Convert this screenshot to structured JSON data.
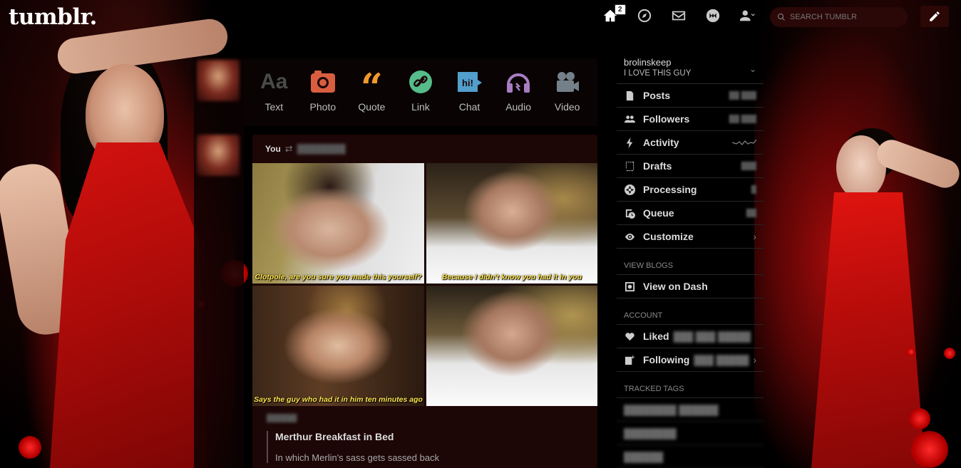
{
  "header": {
    "logo": "tumblr.",
    "home_badge": "2",
    "search_placeholder": "Search Tumblr"
  },
  "post_types": [
    {
      "label": "Text",
      "icon": "text-icon",
      "color": "#4a4a4a"
    },
    {
      "label": "Photo",
      "icon": "camera-icon",
      "color": "#d95e40"
    },
    {
      "label": "Quote",
      "icon": "quote-icon",
      "color": "#f2992e"
    },
    {
      "label": "Link",
      "icon": "link-icon",
      "color": "#56bc8a"
    },
    {
      "label": "Chat",
      "icon": "chat-icon",
      "color": "#529ecc"
    },
    {
      "label": "Audio",
      "icon": "headphones-icon",
      "color": "#a77dc2"
    },
    {
      "label": "Video",
      "icon": "video-camera-icon",
      "color": "#748089"
    }
  ],
  "post": {
    "author": "You",
    "gifs": [
      {
        "caption": "Clotpole, are you sure you made this yourself?"
      },
      {
        "caption": "Because I didn't know you had it in you"
      },
      {
        "caption": "Says the guy who had it in him ten minutes ago"
      },
      {
        "caption": ""
      }
    ],
    "quote_title": "Merthur Breakfast in Bed",
    "quote_text": "In which Merlin's sass gets sassed back"
  },
  "sidebar": {
    "blog_name": "brolinskeep",
    "blog_title": "I LOVE THIS GUY",
    "items": [
      {
        "label": "Posts",
        "icon": "posts-icon"
      },
      {
        "label": "Followers",
        "icon": "followers-icon"
      },
      {
        "label": "Activity",
        "icon": "activity-icon"
      },
      {
        "label": "Drafts",
        "icon": "drafts-icon"
      },
      {
        "label": "Processing",
        "icon": "processing-icon"
      },
      {
        "label": "Queue",
        "icon": "queue-icon"
      },
      {
        "label": "Customize",
        "icon": "eye-icon"
      }
    ],
    "view_blogs_label": "View Blogs",
    "view_on_dash": "View on Dash",
    "account_label": "Account",
    "liked_label": "Liked",
    "following_label": "Following",
    "tracked_tags_label": "Tracked Tags"
  },
  "colors": {
    "accent_red": "#b80c0a",
    "post_bg": "#1d0606",
    "caption_yellow": "#ffe44d"
  }
}
